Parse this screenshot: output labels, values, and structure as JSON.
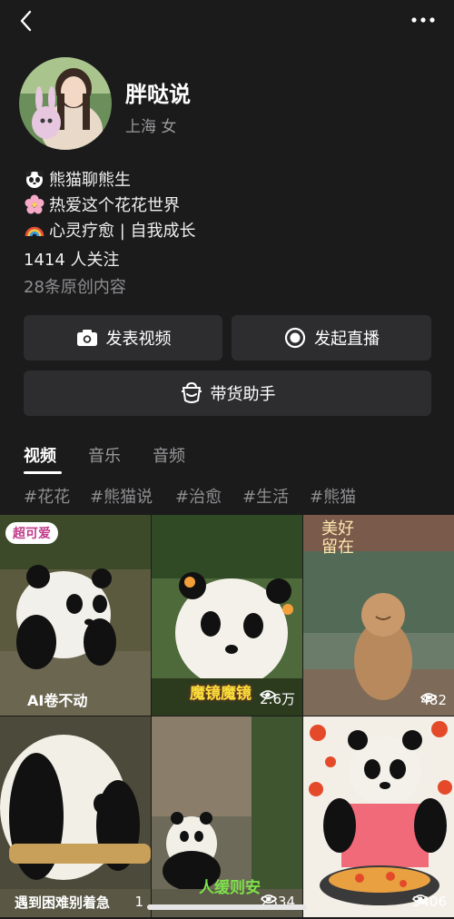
{
  "profile": {
    "name": "胖哒说",
    "location": "上海 女",
    "bio": [
      {
        "emoji": "panda-emoji",
        "text": "熊猫聊熊生"
      },
      {
        "emoji": "cherry-blossom-emoji",
        "text": "热爱这个花花世界"
      },
      {
        "emoji": "rainbow-emoji",
        "text": "心灵疗愈 | 自我成长"
      }
    ],
    "followers": "1414 人关注",
    "original_count": "28条原创内容"
  },
  "actions": {
    "post_video": "发表视频",
    "start_live": "发起直播",
    "sales_assistant": "带货助手"
  },
  "tabs": [
    "视频",
    "音乐",
    "音频"
  ],
  "active_tab": "视频",
  "hashtags": [
    "#花花",
    "#熊猫说",
    "#治愈",
    "#生活",
    "#熊猫"
  ],
  "videos": [
    {
      "overlay_top": "超可爱",
      "overlay_bottom": "AI卷不动",
      "views": ""
    },
    {
      "overlay_bottom": "魔镜魔镜",
      "views": "2.6万"
    },
    {
      "overlay_top": "美好留在",
      "views": "482"
    },
    {
      "overlay_bottom": "遇到困难别着急",
      "views": "1"
    },
    {
      "overlay_bottom": "人缓则安",
      "views": "2334"
    },
    {
      "views": "3406"
    }
  ],
  "colors": {
    "background": "#1b1b1c",
    "button": "#2d2d2f",
    "muted": "#8e8e90",
    "overlay_yellow": "#f5e23a",
    "overlay_green": "#7ee04a"
  }
}
